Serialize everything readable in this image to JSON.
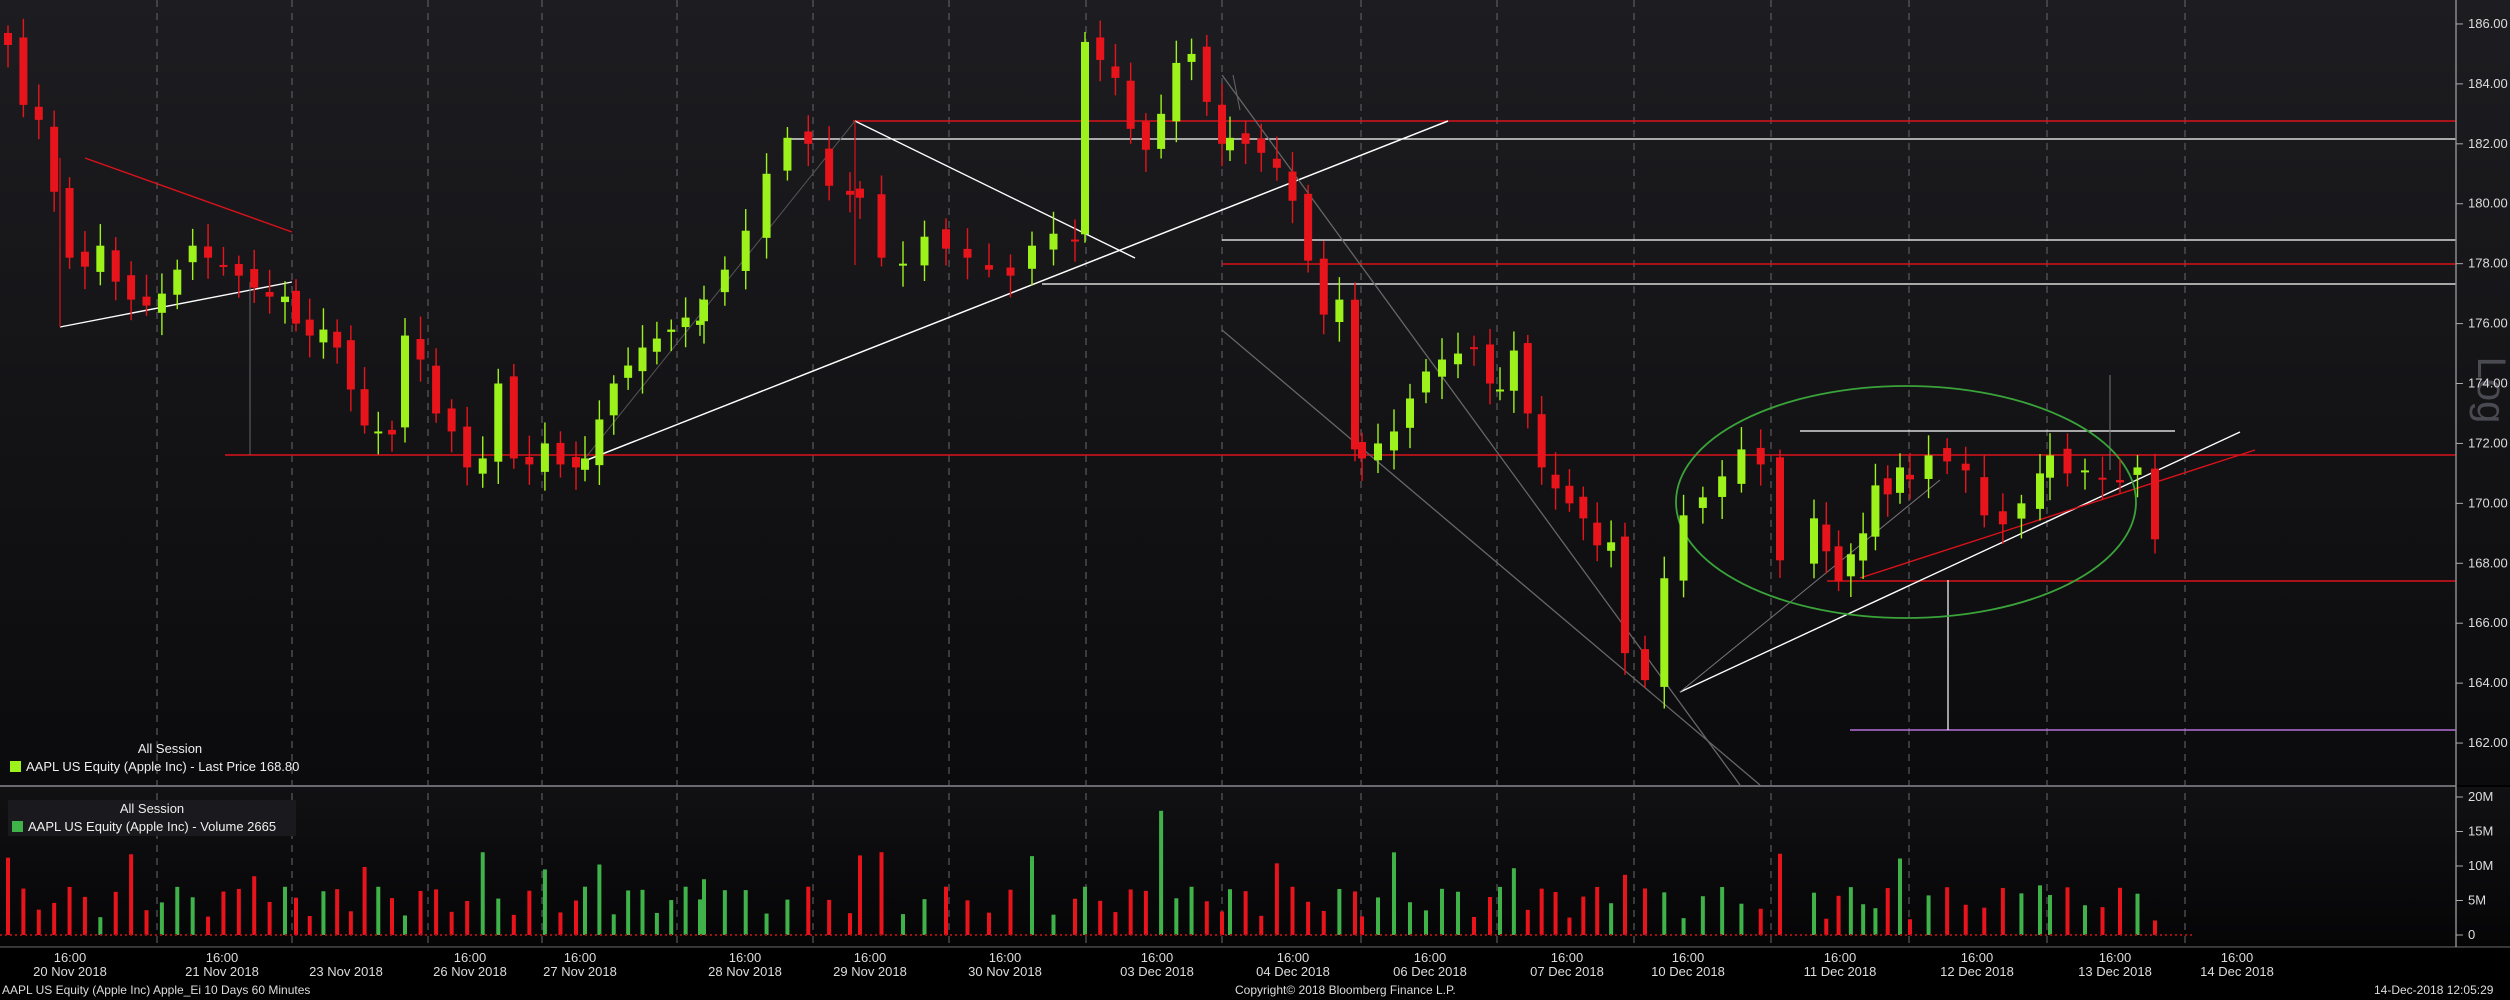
{
  "price_legend": {
    "session": "All Session",
    "series": "AAPL US Equity (Apple Inc) - Last Price 168.80",
    "color": "#9cf21a"
  },
  "volume_legend": {
    "session": "All Session",
    "series": "AAPL US Equity (Apple Inc) - Volume 2665",
    "color": "#3fb24a"
  },
  "footer": {
    "security": "AAPL US Equity (Apple Inc) Apple_Ei 10 Days 60 Minutes",
    "copyright": "Copyright© 2018 Bloomberg Finance L.P.",
    "timestamp": "14-Dec-2018 12:05:29"
  },
  "watermark": "Log",
  "colors": {
    "up": "#9cf21a",
    "down": "#e8141c",
    "trend": "#ffffff",
    "level": "#d9121a",
    "ellipse": "#3aa33a",
    "target": "#b46ed8",
    "volume_up": "#3fb24a",
    "volume_down": "#e8141c"
  },
  "chart_data": [
    {
      "type": "candlestick",
      "title": "AAPL US Equity (Apple Inc) - Last Price 168.80",
      "ylim": [
        160.6,
        186.8
      ],
      "y_ticks": [
        162,
        164,
        166,
        168,
        170,
        172,
        174,
        176,
        178,
        180,
        182,
        184,
        186
      ],
      "y_tick_labels": [
        "162.00",
        "164.00",
        "166.00",
        "168.00",
        "170.00",
        "172.00",
        "174.00",
        "176.00",
        "178.00",
        "180.00",
        "182.00",
        "184.00",
        "186.00"
      ],
      "x_tick_labels": [
        {
          "time": "16:00",
          "date": "20 Nov 2018"
        },
        {
          "time": "16:00",
          "date": "21 Nov 2018"
        },
        {
          "time": "",
          "date": "23 Nov 2018"
        },
        {
          "time": "16:00",
          "date": "26 Nov 2018"
        },
        {
          "time": "16:00",
          "date": "27 Nov 2018"
        },
        {
          "time": "16:00",
          "date": "28 Nov 2018"
        },
        {
          "time": "16:00",
          "date": "29 Nov 2018"
        },
        {
          "time": "16:00",
          "date": "30 Nov 2018"
        },
        {
          "time": "16:00",
          "date": "03 Dec 2018"
        },
        {
          "time": "16:00",
          "date": "04 Dec 2018"
        },
        {
          "time": "16:00",
          "date": "06 Dec 2018"
        },
        {
          "time": "16:00",
          "date": "07 Dec 2018"
        },
        {
          "time": "16:00",
          "date": "10 Dec 2018"
        },
        {
          "time": "16:00",
          "date": "11 Dec 2018"
        },
        {
          "time": "16:00",
          "date": "12 Dec 2018"
        },
        {
          "time": "16:00",
          "date": "13 Dec 2018"
        },
        {
          "time": "16:00",
          "date": "14 Dec 2018"
        }
      ],
      "last_price": 168.8,
      "close": [
        185.3,
        183.3,
        182.8,
        180.4,
        178.2,
        177.9,
        178.6,
        177.4,
        176.8,
        176.6,
        177.0,
        177.8,
        178.6,
        178.2,
        177.9,
        177.6,
        177.2,
        176.9,
        176.9,
        176.0,
        175.6,
        175.8,
        175.2,
        173.8,
        172.6,
        172.4,
        172.3,
        175.6,
        174.8,
        173.0,
        172.4,
        171.2,
        171.5,
        174.0,
        171.5,
        171.3,
        172.0,
        171.3,
        171.2,
        171.5,
        172.8,
        174.0,
        174.6,
        175.2,
        175.5,
        175.8,
        176.2,
        176.1,
        176.8,
        177.8,
        179.1,
        181.0,
        182.2,
        182.0,
        180.6,
        180.3,
        180.2,
        178.2,
        178.0,
        178.9,
        178.5,
        178.2,
        177.8,
        177.6,
        178.6,
        179.0,
        178.8,
        185.4,
        184.8,
        184.2,
        182.5,
        181.8,
        183.0,
        184.7,
        185.0,
        183.4,
        182.0,
        182.2,
        182.0,
        181.7,
        181.2,
        180.1,
        178.1,
        176.3,
        176.8,
        171.8,
        171.5,
        172.0,
        172.4,
        173.5,
        174.4,
        174.8,
        175.0,
        175.2,
        174.0,
        173.8,
        175.1,
        173.0,
        171.2,
        170.5,
        170.0,
        169.5,
        168.6,
        168.7,
        165.0,
        164.1,
        167.5,
        169.6,
        170.2,
        170.9,
        171.8,
        171.3,
        168.1,
        169.5,
        168.4,
        167.4,
        168.3,
        169.0,
        170.6,
        170.3,
        171.2,
        170.8,
        171.6,
        171.4,
        171.1,
        169.6,
        169.3,
        170.0,
        171.0,
        171.6,
        171.0,
        171.1,
        170.8,
        170.7,
        171.2,
        168.8
      ],
      "high_low_shown": true
    },
    {
      "type": "bar",
      "title": "AAPL US Equity (Apple Inc) - Volume 2665",
      "y_tick_labels": [
        "0",
        "5M",
        "10M",
        "15M",
        "20M"
      ],
      "y_ticks": [
        0,
        5000000,
        10000000,
        15000000,
        20000000
      ],
      "last_volume": 2665
    }
  ]
}
